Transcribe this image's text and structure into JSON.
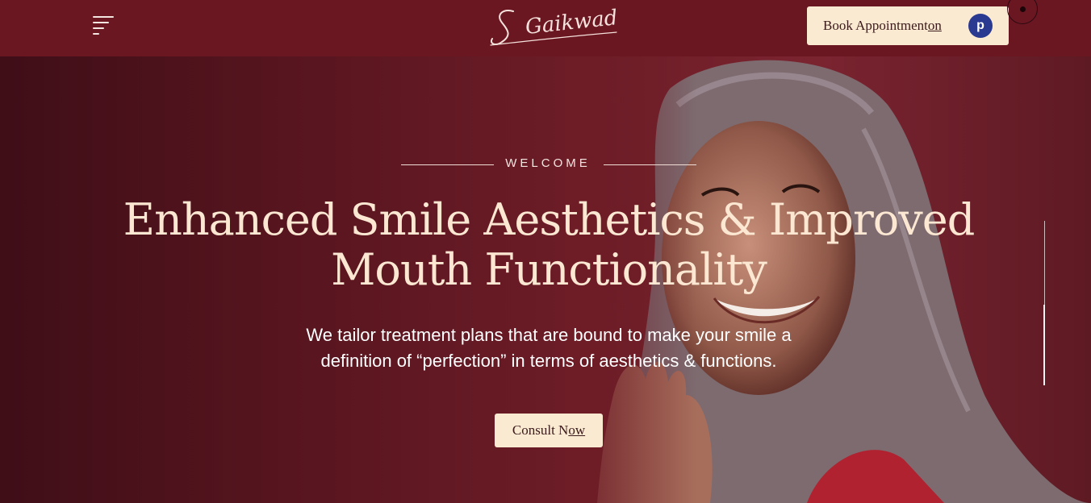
{
  "header": {
    "logo_text": "S Gaikwad",
    "book_label": "Book Appointment",
    "book_on": "on",
    "practo_letter": "p"
  },
  "hero": {
    "eyebrow": "WELCOME",
    "headline_line1": "Enhanced Smile Aesthetics & Improved",
    "headline_line2": "Mouth Functionality",
    "subtext_line1": "We tailor treatment plans that are bound to make your smile a",
    "subtext_line2": "definition of “perfection” in terms of aesthetics & functions.",
    "cta_prefix": "Consult N",
    "cta_underlined": "ow"
  },
  "colors": {
    "topbar": "#6a1722",
    "hero_bg": "#5a1620",
    "accent_cream": "#fbead2",
    "headline": "#fbe7d2",
    "practo_blue": "#2b3a91"
  },
  "icons": [
    "hamburger-menu-icon",
    "practo-logo-icon",
    "circle-cursor-icon"
  ]
}
